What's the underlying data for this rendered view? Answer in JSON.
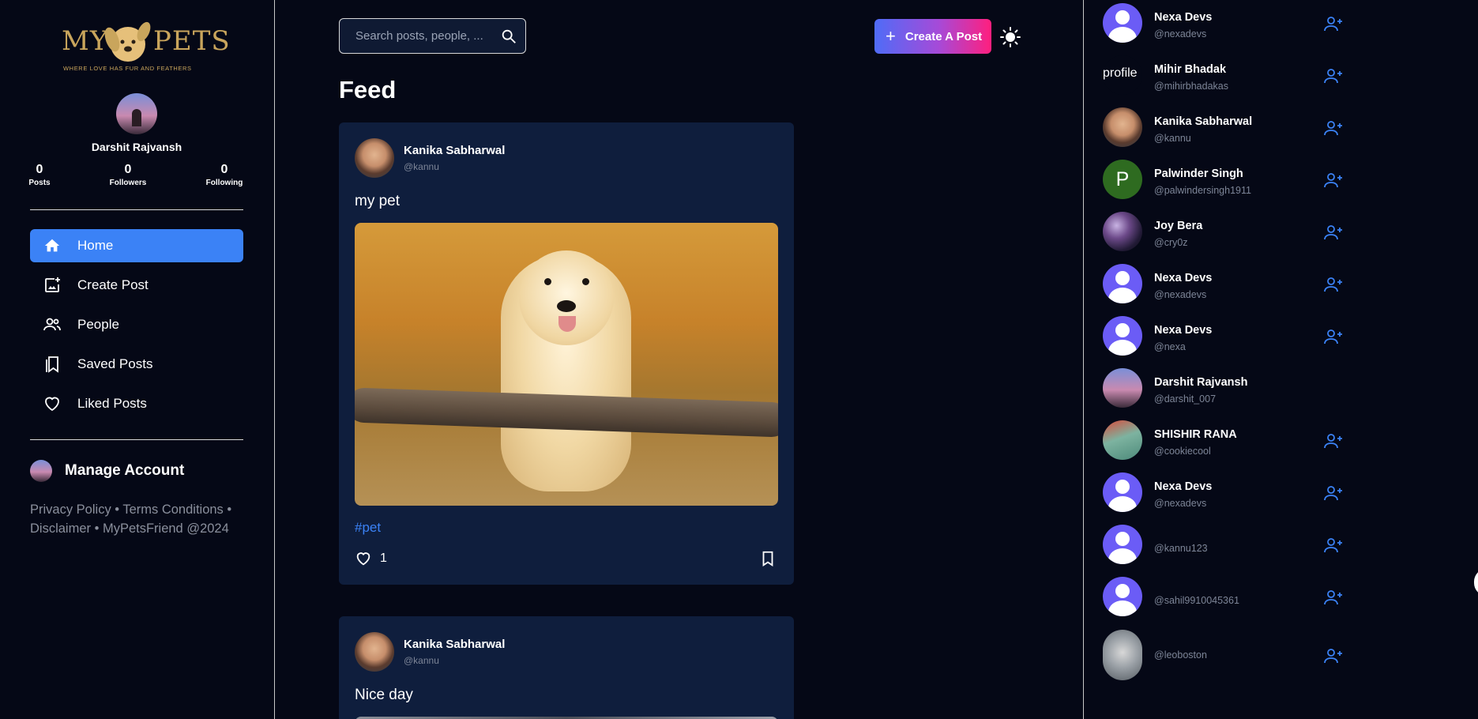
{
  "brand": {
    "logo_left": "MY",
    "logo_right": "PETS",
    "tagline": "WHERE LOVE HAS FUR AND FEATHERS",
    "logo_color": "#c9a55c"
  },
  "profile": {
    "name": "Darshit Rajvansh",
    "stats": [
      {
        "value": "0",
        "label": "Posts"
      },
      {
        "value": "0",
        "label": "Followers"
      },
      {
        "value": "0",
        "label": "Following"
      }
    ]
  },
  "nav": {
    "items": [
      {
        "label": "Home",
        "icon": "home-icon",
        "active": true
      },
      {
        "label": "Create Post",
        "icon": "add-photo-icon"
      },
      {
        "label": "People",
        "icon": "people-icon"
      },
      {
        "label": "Saved Posts",
        "icon": "bookmarks-icon"
      },
      {
        "label": "Liked Posts",
        "icon": "heart-icon"
      }
    ],
    "manage_account": "Manage Account",
    "footer": "Privacy Policy • Terms Conditions • Disclaimer • MyPetsFriend @2024"
  },
  "header": {
    "search_placeholder": "Search posts, people, ...",
    "create_label": "Create A Post",
    "feed_title": "Feed"
  },
  "posts": [
    {
      "author": "Kanika Sabharwal",
      "handle": "@kannu",
      "text": "my pet",
      "tag": "#pet",
      "likes": "1"
    },
    {
      "author": "Kanika Sabharwal",
      "handle": "@kannu",
      "text": "Nice day"
    }
  ],
  "suggestions": [
    {
      "name": "Nexa Devs",
      "handle": "@nexadevs",
      "avatar": "default",
      "follow": true
    },
    {
      "name": "Mihir Bhadak",
      "handle": "@mihirbhadakas",
      "avatar": "broken",
      "alt": "profile",
      "follow": true
    },
    {
      "name": "Kanika Sabharwal",
      "handle": "@kannu",
      "avatar": "kanika",
      "follow": true
    },
    {
      "name": "Palwinder Singh",
      "handle": "@palwindersingh1911",
      "avatar": "letter",
      "letter": "P",
      "follow": true
    },
    {
      "name": "Joy Bera",
      "handle": "@cry0z",
      "avatar": "joy",
      "follow": true
    },
    {
      "name": "Nexa Devs",
      "handle": "@nexadevs",
      "avatar": "default",
      "follow": true
    },
    {
      "name": "Nexa Devs",
      "handle": "@nexa",
      "avatar": "default",
      "follow": true
    },
    {
      "name": "Darshit Rajvansh",
      "handle": "@darshit_007",
      "avatar": "darshit",
      "follow": false
    },
    {
      "name": "SHISHIR RANA",
      "handle": "@cookiecool",
      "avatar": "shishir",
      "follow": true
    },
    {
      "name": "Nexa Devs",
      "handle": "@nexadevs",
      "avatar": "default",
      "follow": true
    },
    {
      "name": "",
      "handle": "@kannu123",
      "avatar": "default",
      "follow": true
    },
    {
      "name": "",
      "handle": "@sahil9910045361",
      "avatar": "default",
      "follow": true
    },
    {
      "name": "",
      "handle": "@leoboston",
      "avatar": "leo",
      "follow": true
    }
  ],
  "colors": {
    "background": "#050816",
    "card": "#0f1e3d",
    "accent": "#3b82f6",
    "muted": "#7d8597"
  }
}
